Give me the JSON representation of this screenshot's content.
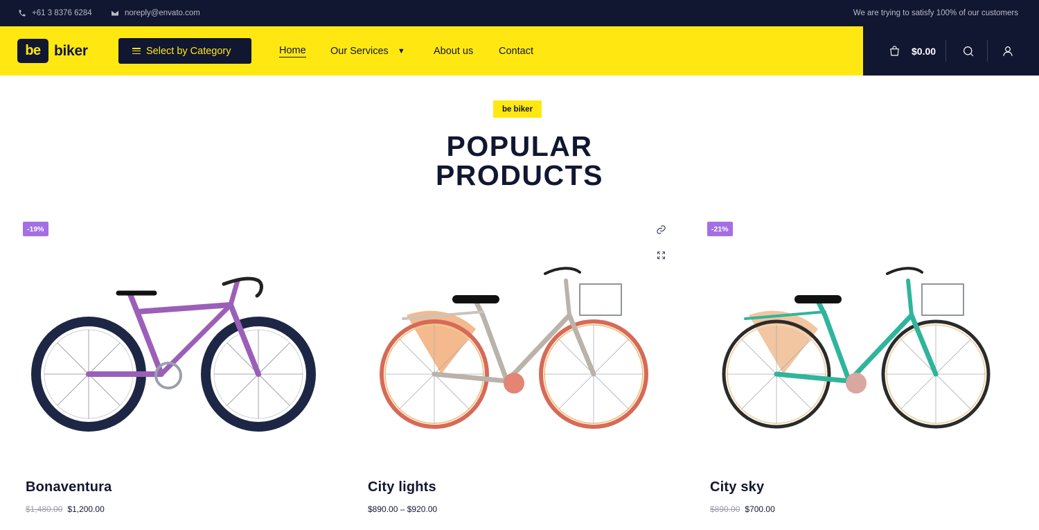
{
  "topbar": {
    "phone": "+61 3 8376 6284",
    "email": "noreply@envato.com",
    "tagline": "We are trying to satisfy 100% of our customers"
  },
  "header": {
    "logo_mark": "be",
    "logo_text": "biker",
    "category_button": "Select by Category",
    "nav": {
      "home": "Home",
      "services": "Our Services",
      "about": "About us",
      "contact": "Contact"
    },
    "cart_total": "$0.00",
    "icons": [
      "phone-icon",
      "mail-icon",
      "menu-icon",
      "chevron-down-icon",
      "cart-icon",
      "search-icon",
      "user-icon"
    ]
  },
  "section": {
    "badge": "be biker",
    "title_line1": "POPULAR",
    "title_line2": "PRODUCTS"
  },
  "products": [
    {
      "name": "Bonaventura",
      "sale_badge": "-19%",
      "old_price": "$1,480.00",
      "price": "$1,200.00",
      "frame_color": "#9b5fb8"
    },
    {
      "name": "City lights",
      "sale_badge": "",
      "old_price": "",
      "price": "$890.00 – $920.00",
      "frame_color": "#b9b3aa",
      "hover_icons": [
        "link-icon",
        "expand-icon"
      ]
    },
    {
      "name": "City sky",
      "sale_badge": "-21%",
      "old_price": "$890.00",
      "price": "$700.00",
      "frame_color": "#2fb59b"
    }
  ],
  "colors": {
    "brand_yellow": "#ffe812",
    "navy": "#111631",
    "sale_purple": "#a46fe4"
  }
}
